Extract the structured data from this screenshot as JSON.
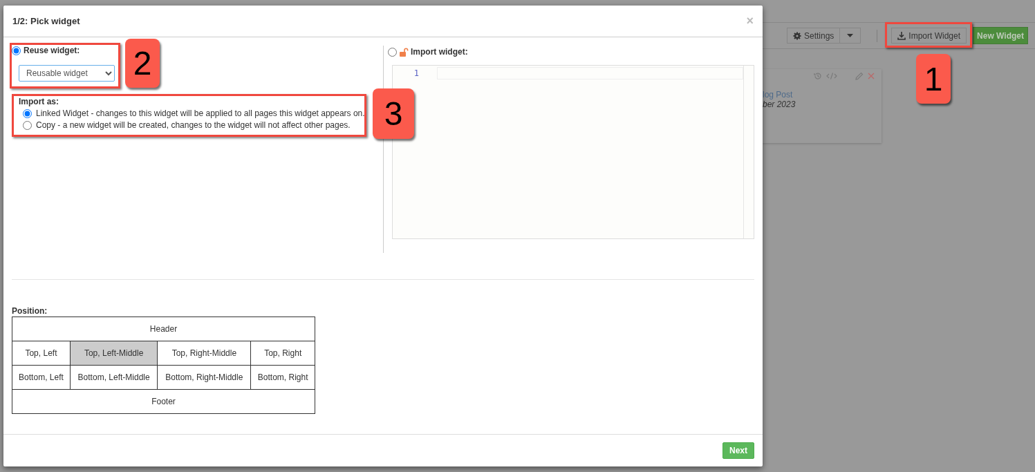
{
  "background_page": {
    "toolbar": {
      "settings_button": "Settings",
      "import_button": "Import Widget",
      "new_button": "New Widget"
    },
    "widget_card": {
      "title": "log Post",
      "date": "ber 2023"
    }
  },
  "dialog": {
    "title": "1/2: Pick widget",
    "close": "×",
    "reuse": {
      "label": "Reuse widget:",
      "selected": true,
      "select_value": "Reusable widget"
    },
    "import_as": {
      "label": "Import as:",
      "options": [
        {
          "label": "Linked Widget - changes to this widget will be applied to all pages this widget appears on.",
          "selected": true
        },
        {
          "label": "Copy - a new widget will be created, changes to the widget will not affect other pages.",
          "selected": false
        }
      ]
    },
    "import": {
      "label": "Import widget:",
      "selected": false,
      "line_numbers": [
        "1"
      ]
    },
    "position": {
      "label": "Position:",
      "header": {
        "label": "Header",
        "selected": false
      },
      "rows": [
        [
          {
            "label": "Top, Left",
            "selected": false
          },
          {
            "label": "Top, Left-Middle",
            "selected": true
          },
          {
            "label": "Top, Right-Middle",
            "selected": false
          },
          {
            "label": "Top, Right",
            "selected": false
          }
        ],
        [
          {
            "label": "Bottom, Left",
            "selected": false
          },
          {
            "label": "Bottom, Left-Middle",
            "selected": false
          },
          {
            "label": "Bottom, Right-Middle",
            "selected": false
          },
          {
            "label": "Bottom, Right",
            "selected": false
          }
        ]
      ],
      "footer": {
        "label": "Footer",
        "selected": false
      }
    },
    "next_button": "Next"
  },
  "annotations": [
    {
      "number": "1"
    },
    {
      "number": "2"
    },
    {
      "number": "3"
    }
  ]
}
